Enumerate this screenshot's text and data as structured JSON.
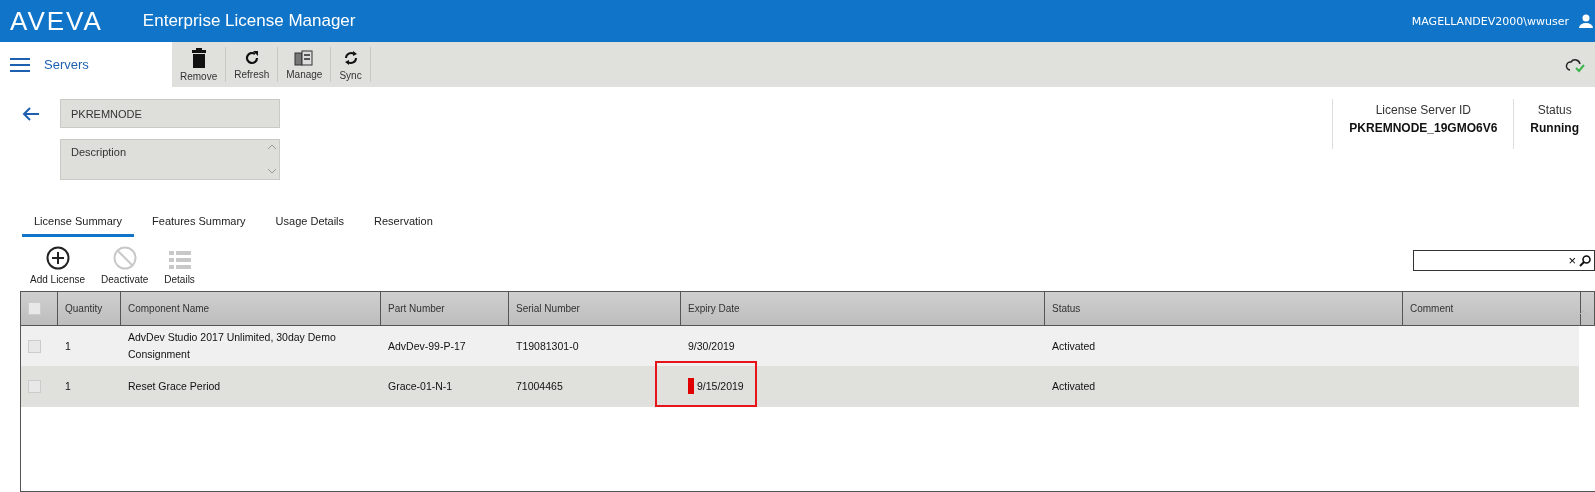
{
  "header": {
    "logo": "AVEVA",
    "title": "Enterprise License Manager",
    "user": "MAGELLANDEV2000\\wwuser"
  },
  "nav": {
    "label": "Servers"
  },
  "toolbar": [
    {
      "label": "Remove",
      "kind": "trash"
    },
    {
      "label": "Refresh",
      "kind": "refresh"
    },
    {
      "label": "Manage",
      "kind": "manage"
    },
    {
      "label": "Sync",
      "kind": "sync"
    }
  ],
  "server": {
    "name": "PKREMNODE",
    "description_placeholder": "Description",
    "id_label": "License Server ID",
    "id": "PKREMNODE_19GMO6V6",
    "status_label": "Status",
    "status": "Running"
  },
  "tabs": [
    {
      "label": "License Summary",
      "selected": true
    },
    {
      "label": "Features Summary",
      "selected": false
    },
    {
      "label": "Usage Details",
      "selected": false
    },
    {
      "label": "Reservation",
      "selected": false
    }
  ],
  "actions": [
    {
      "label": "Add License",
      "kind": "add",
      "disabled": false
    },
    {
      "label": "Deactivate",
      "kind": "deactivate",
      "disabled": true
    },
    {
      "label": "Details",
      "kind": "details",
      "disabled": true
    }
  ],
  "search": {
    "clear": "×"
  },
  "table": {
    "select_all_checked": false,
    "columns": [
      "Quantity",
      "Component Name",
      "Part Number",
      "Serial Number",
      "Expiry Date",
      "Status",
      "Comment"
    ],
    "rows": [
      {
        "checked": false,
        "selected": false,
        "highlighted": false,
        "cells": [
          "1",
          "AdvDev Studio 2017 Unlimited, 30day Demo Consignment",
          "AdvDev-99-P-17",
          "T19081301-0",
          "9/30/2019",
          "Activated",
          ""
        ]
      },
      {
        "checked": false,
        "selected": true,
        "highlighted": true,
        "cells": [
          "1",
          "Reset Grace Period",
          "Grace-01-N-1",
          "71004465",
          "9/15/2019",
          "Activated",
          ""
        ]
      }
    ]
  }
}
